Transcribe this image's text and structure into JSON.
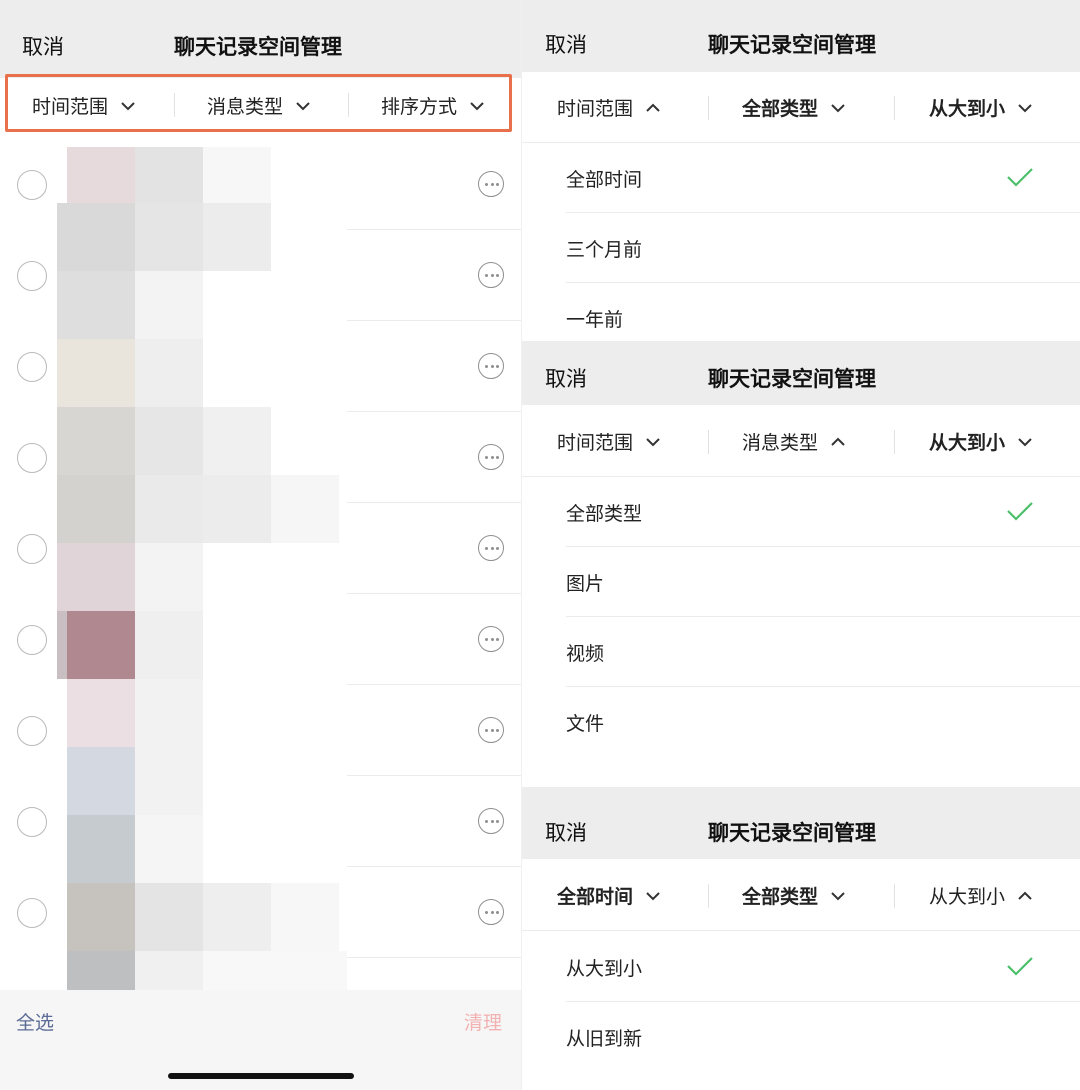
{
  "nav": {
    "cancel": "取消",
    "title": "聊天记录空间管理"
  },
  "left": {
    "filters": [
      "时间范围",
      "消息类型",
      "排序方式"
    ],
    "footer": {
      "select_all": "全选",
      "clean": "清理"
    },
    "highlight_color": "#e8704a"
  },
  "panel1": {
    "filters": [
      "时间范围",
      "全部类型",
      "从大到小"
    ],
    "open_filter": "时间范围",
    "options": [
      "全部时间",
      "三个月前",
      "一年前"
    ],
    "selected": "全部时间"
  },
  "panel2": {
    "filters": [
      "时间范围",
      "消息类型",
      "从大到小"
    ],
    "open_filter": "消息类型",
    "options": [
      "全部类型",
      "图片",
      "视频",
      "文件"
    ],
    "selected": "全部类型"
  },
  "panel3": {
    "filters": [
      "全部时间",
      "全部类型",
      "从大到小"
    ],
    "open_filter": "从大到小",
    "options": [
      "从大到小",
      "从旧到新"
    ],
    "selected": "从大到小"
  },
  "colors": {
    "check": "#4cbf6a",
    "nav_bg": "#ededed",
    "select_all": "#5b6b95",
    "clean_disabled": "#f3b2b2"
  },
  "icons": {
    "chevron_down": "chevron-down-icon",
    "chevron_up": "chevron-up-icon",
    "check": "check-icon",
    "more": "more-icon",
    "radio": "radio-icon"
  }
}
